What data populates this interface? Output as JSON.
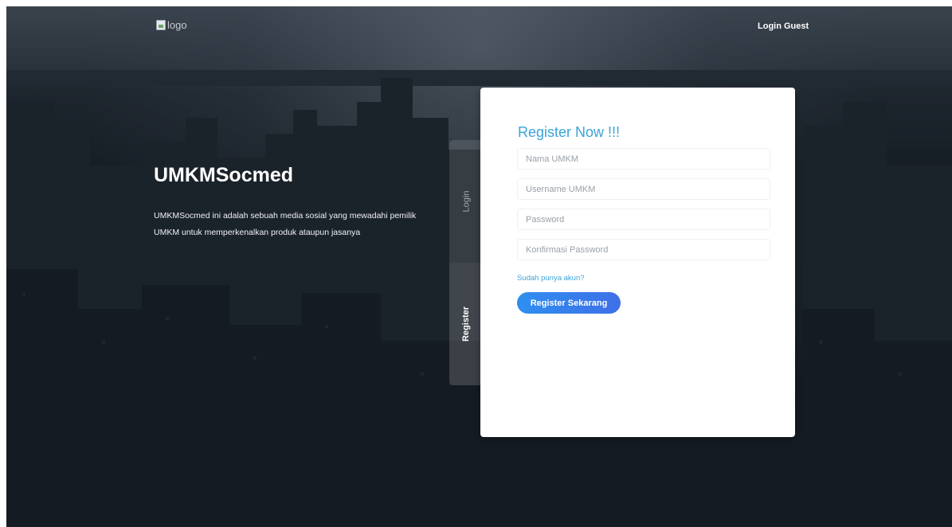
{
  "header": {
    "logo_alt": "logo",
    "login_guest": "Login Guest"
  },
  "hero": {
    "title": "UMKMSocmed",
    "description": "UMKMSocmed ini adalah sebuah media sosial yang mewadahi pemilik UMKM untuk memperkenalkan produk ataupun jasanya"
  },
  "side_tabs": {
    "login": "Login",
    "register": "Register"
  },
  "form": {
    "title": "Register Now !!!",
    "fields": {
      "nama_placeholder": "Nama UMKM",
      "username_placeholder": "Username UMKM",
      "password_placeholder": "Password",
      "confirm_placeholder": "Konfirmasi Password"
    },
    "login_link": "Sudah punya akun?",
    "submit": "Register Sekarang"
  },
  "colors": {
    "accent": "#3aa3d8",
    "button": "#2e8ff0"
  }
}
